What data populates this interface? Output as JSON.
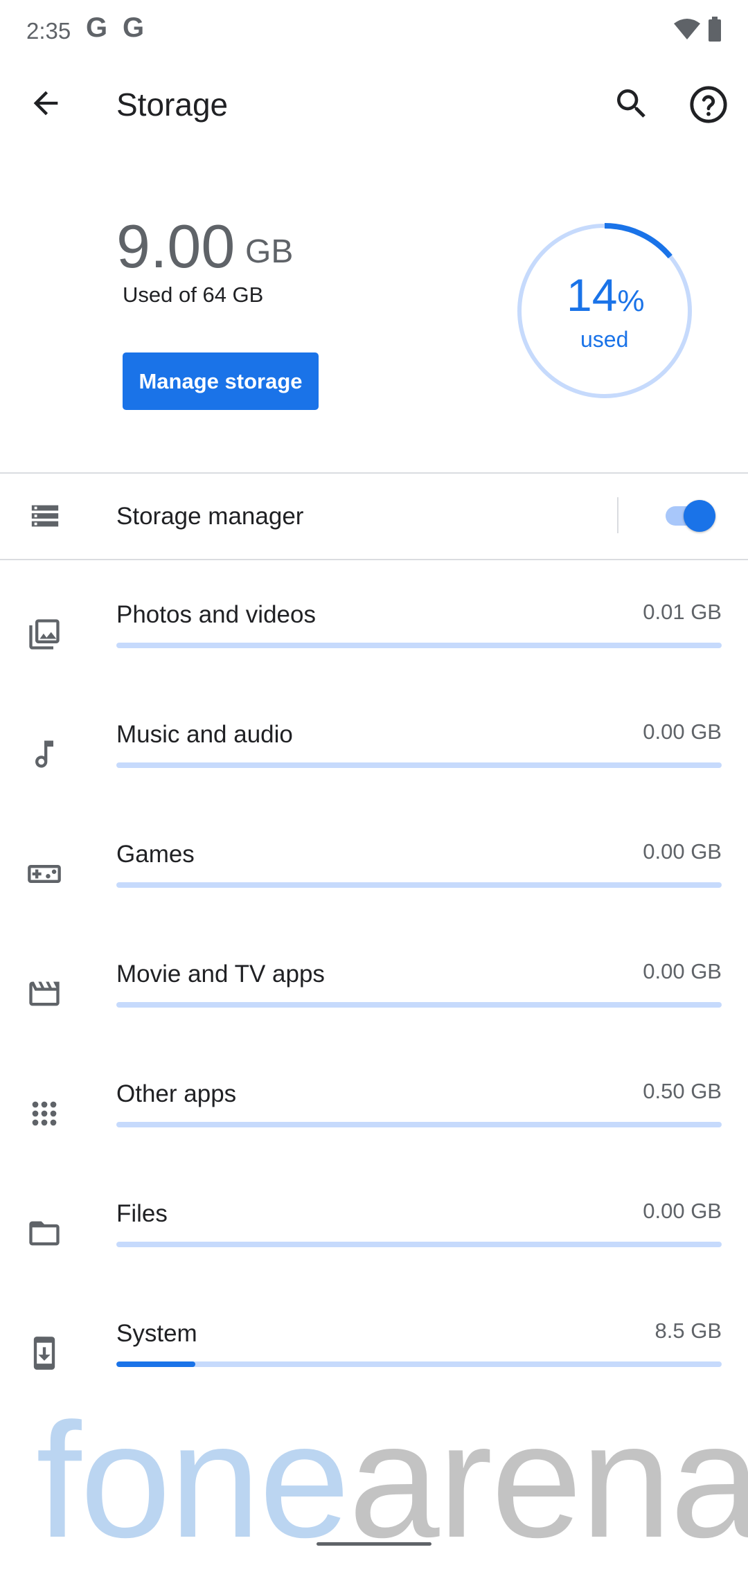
{
  "status_bar": {
    "time": "2:35",
    "notification_icons": [
      "G",
      "G"
    ],
    "right_icons": [
      "wifi-icon",
      "battery-icon"
    ]
  },
  "app_bar": {
    "title": "Storage",
    "icons": [
      "back-arrow-icon",
      "search-icon",
      "help-icon"
    ]
  },
  "summary": {
    "used_amount": "9.00",
    "used_unit": "GB",
    "used_of": "Used of 64 GB",
    "manage_button": "Manage storage",
    "percent_used": 14,
    "percent_value": "14",
    "percent_sign": "%",
    "percent_label": "used"
  },
  "storage_manager": {
    "label": "Storage manager",
    "enabled": true
  },
  "categories": [
    {
      "label": "Photos and videos",
      "size": "0.01 GB",
      "fraction": 0.0,
      "icon": "photos-icon"
    },
    {
      "label": "Music and audio",
      "size": "0.00 GB",
      "fraction": 0.0,
      "icon": "music-note-icon"
    },
    {
      "label": "Games",
      "size": "0.00 GB",
      "fraction": 0.0,
      "icon": "gamepad-icon"
    },
    {
      "label": "Movie and TV apps",
      "size": "0.00 GB",
      "fraction": 0.0,
      "icon": "clapperboard-icon"
    },
    {
      "label": "Other apps",
      "size": "0.50 GB",
      "fraction": 0.0,
      "icon": "apps-grid-icon"
    },
    {
      "label": "Files",
      "size": "0.00 GB",
      "fraction": 0.0,
      "icon": "folder-icon"
    },
    {
      "label": "System",
      "size": "8.5 GB",
      "fraction": 0.13,
      "icon": "system-update-icon"
    }
  ],
  "watermark": {
    "part1": "fone",
    "part2": "arena"
  },
  "colors": {
    "accent": "#1a73e8",
    "track": "#c6dafc",
    "secondary_text": "#5f6368"
  }
}
